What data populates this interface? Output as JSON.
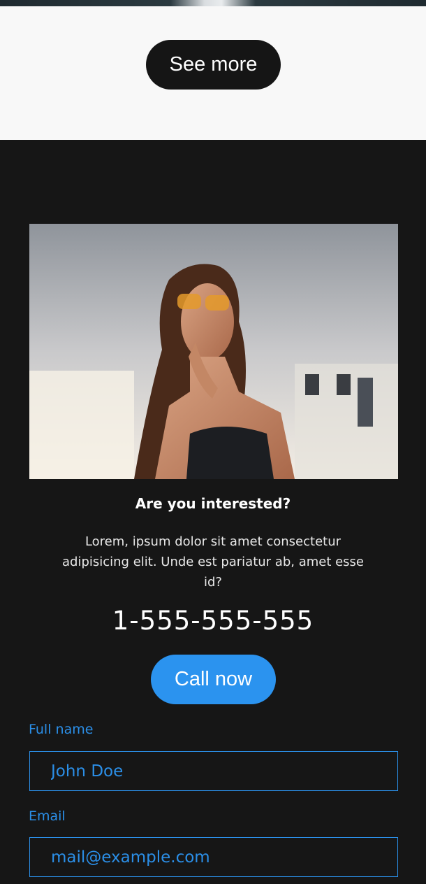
{
  "see_more": {
    "label": "See more"
  },
  "contact": {
    "heading": "Are you interested?",
    "paragraph": "Lorem, ipsum dolor sit amet consectetur adipisicing elit. Unde est pariatur ab, amet esse id?",
    "phone": "1-555-555-555",
    "call_label": "Call now"
  },
  "form": {
    "full_name": {
      "label": "Full name",
      "placeholder": "John Doe"
    },
    "email": {
      "label": "Email",
      "placeholder": "mail@example.com"
    }
  },
  "colors": {
    "accent": "#2b93ef",
    "dark_bg": "#161616",
    "light_bg": "#f8f8f8"
  }
}
